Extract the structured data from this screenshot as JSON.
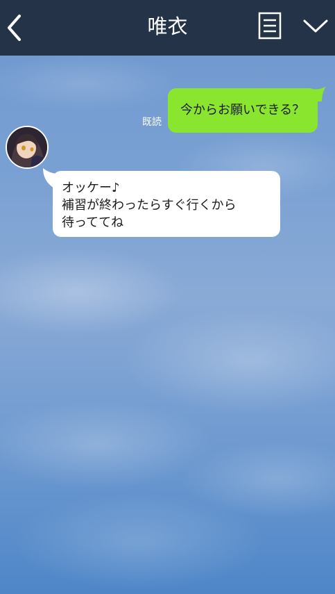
{
  "header": {
    "title": "唯衣",
    "back_icon": "chevron-left-icon",
    "notes_icon": "notes-icon",
    "menu_icon": "chevron-down-icon",
    "background": "#243348"
  },
  "messages": [
    {
      "direction": "outgoing",
      "status": "既読",
      "text": "今からお願いできる？",
      "color": "#8ae52e"
    },
    {
      "direction": "incoming",
      "avatar": "avatar",
      "lines": [
        "オッケー♪",
        "補習が終わったらすぐ行くから",
        "待っててね"
      ],
      "color": "#ffffff"
    }
  ]
}
